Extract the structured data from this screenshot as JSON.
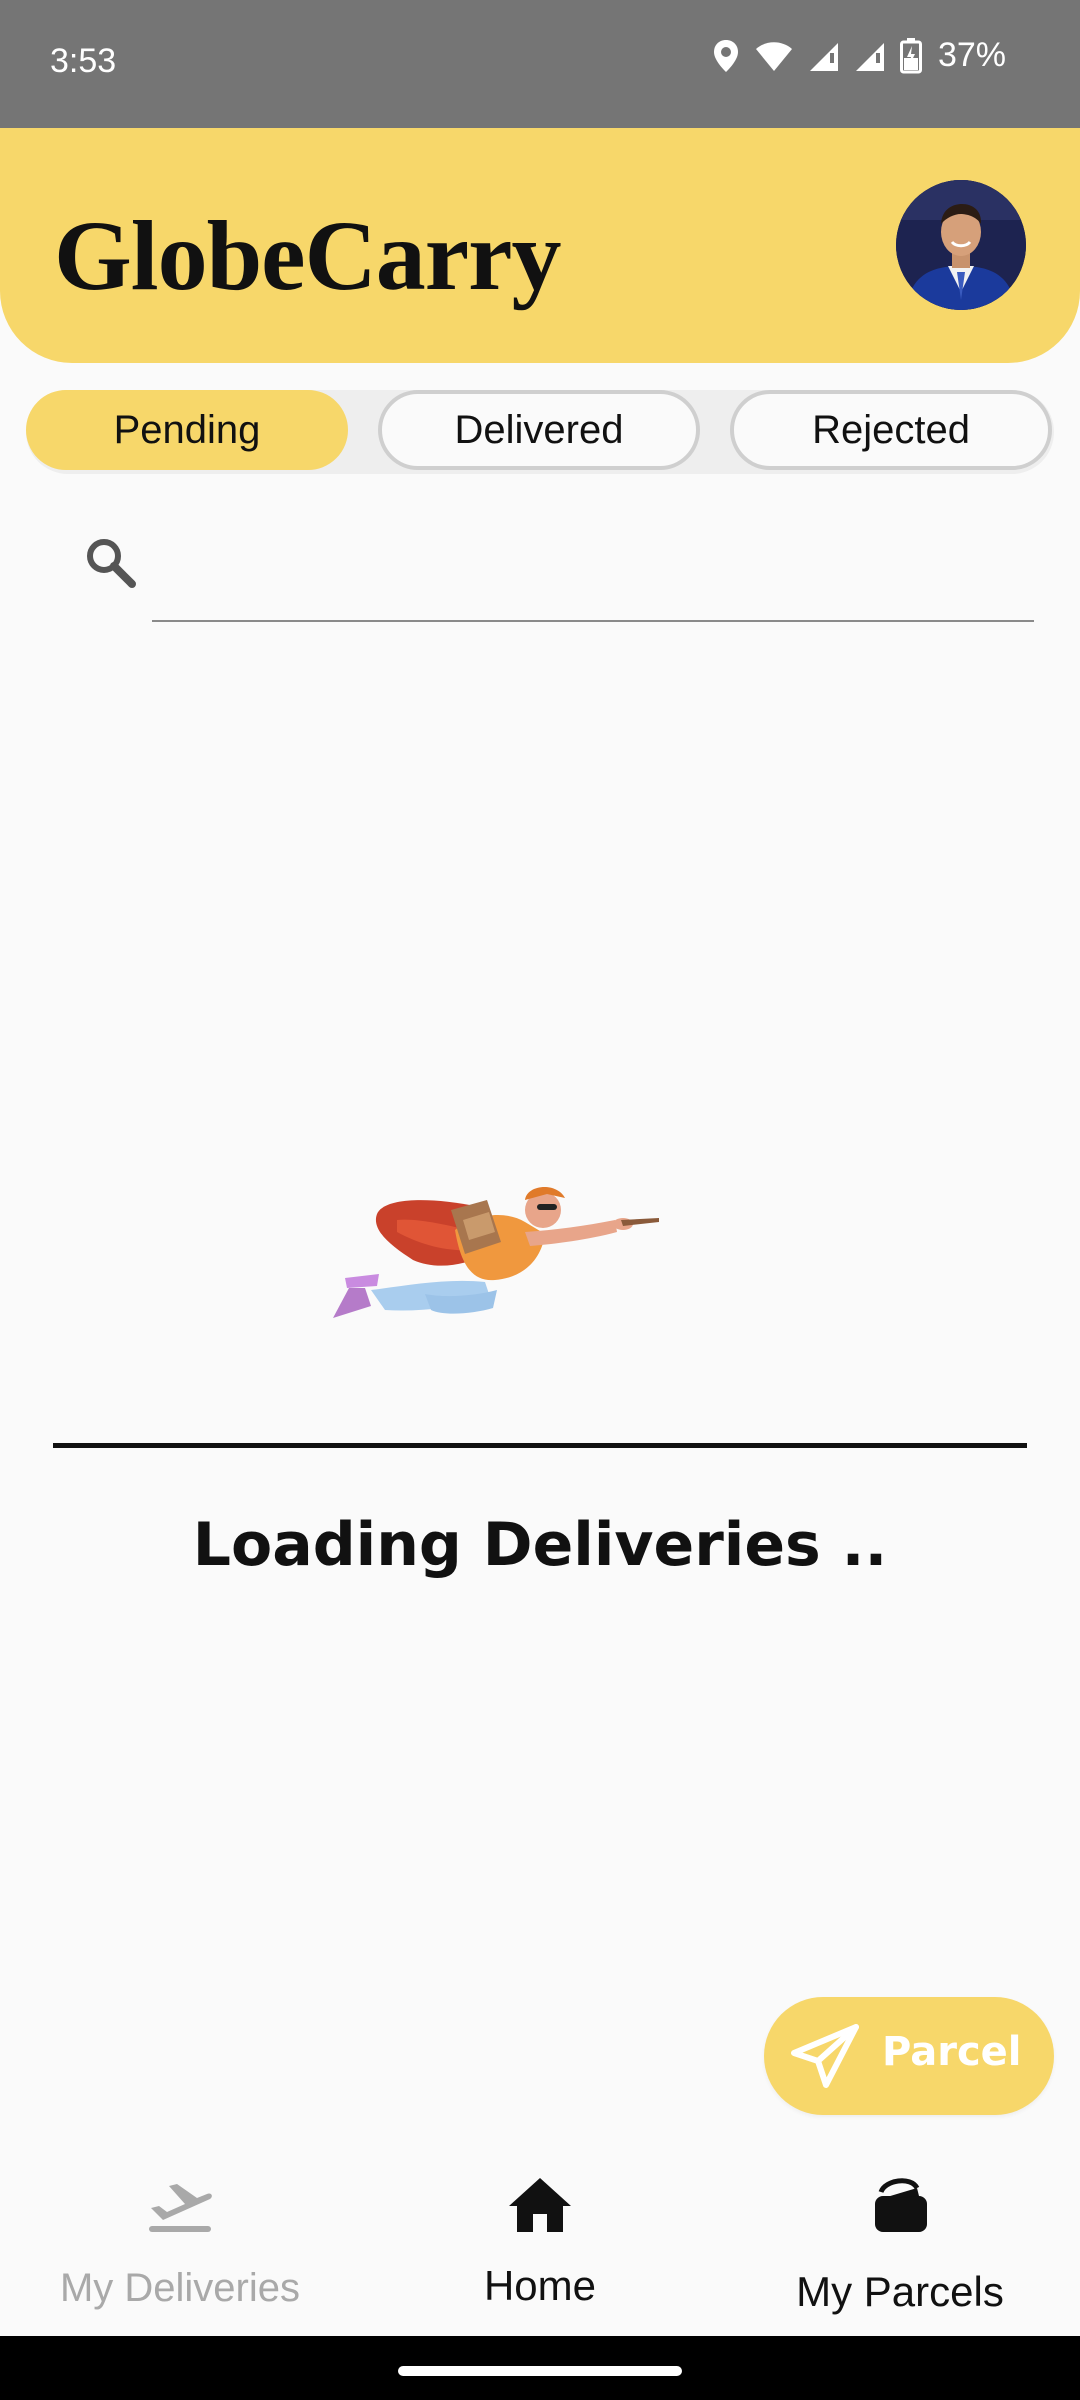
{
  "status_bar": {
    "time": "3:53",
    "battery": "37%",
    "icons": [
      "location-icon",
      "wifi-icon",
      "signal-icon",
      "signal-icon",
      "battery-charging-icon"
    ]
  },
  "header": {
    "title": "GlobeCarry",
    "avatar_icon": "profile-avatar"
  },
  "tabs": [
    {
      "label": "Pending",
      "active": true
    },
    {
      "label": "Delivered",
      "active": false
    },
    {
      "label": "Rejected",
      "active": false
    }
  ],
  "search": {
    "placeholder": "",
    "icon": "search-icon"
  },
  "main": {
    "illustration": "flying-courier-illustration",
    "loading_text": "Loading Deliveries .."
  },
  "fab": {
    "label": "Parcel",
    "icon": "paper-plane-icon"
  },
  "bottom_nav": {
    "items": [
      {
        "label": "My Deliveries",
        "icon": "plane-takeoff-icon",
        "active": false
      },
      {
        "label": "Home",
        "icon": "home-icon",
        "active": true
      },
      {
        "label": "My Parcels",
        "icon": "shopping-bag-icon",
        "active": false
      }
    ]
  },
  "colors": {
    "accent": "#f7d76a",
    "status_bar": "#757575",
    "background": "#fafafa",
    "inactive_text": "#a9a9a9"
  }
}
